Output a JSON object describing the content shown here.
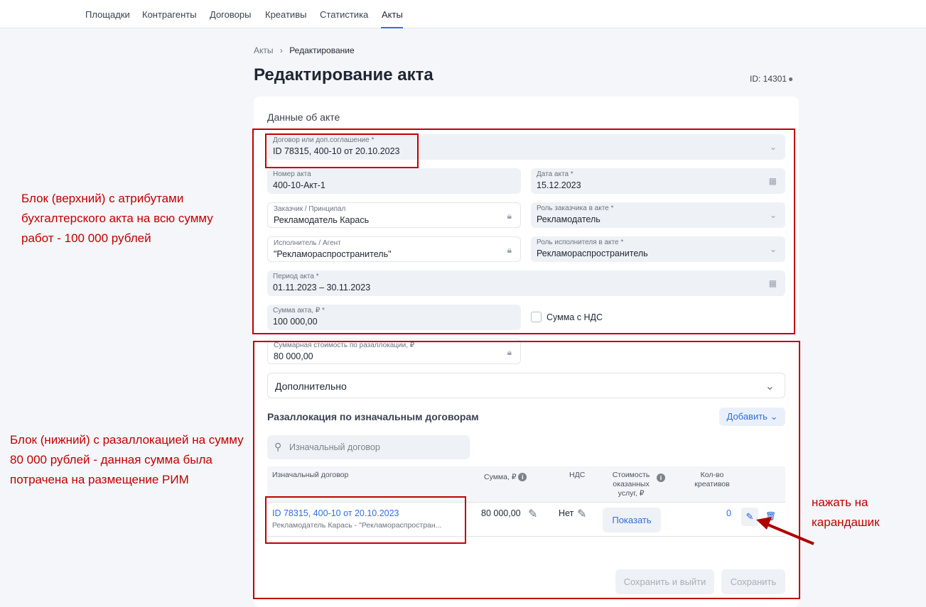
{
  "nav": {
    "items": [
      "Площадки",
      "Контрагенты",
      "Договоры",
      "Креативы",
      "Статистика",
      "Акты"
    ],
    "active": "Акты"
  },
  "breadcrumb": {
    "root": "Акты",
    "current": "Редактирование"
  },
  "page": {
    "title": "Редактирование акта",
    "id": "ID: 14301"
  },
  "form": {
    "section_title": "Данные об акте",
    "contract": {
      "label": "Договор или доп.соглашение *",
      "value": "ID 78315, 400-10 от 20.10.2023"
    },
    "act_number": {
      "label": "Номер акта",
      "value": "400-10-Акт-1"
    },
    "act_date": {
      "label": "Дата акта *",
      "value": "15.12.2023"
    },
    "customer": {
      "label": "Заказчик / Принципал",
      "value": "Рекламодатель Карась"
    },
    "customer_role": {
      "label": "Роль заказчика в акте *",
      "value": "Рекламодатель"
    },
    "executor": {
      "label": "Исполнитель / Агент",
      "value": "\"Рекламораспространитель\""
    },
    "executor_role": {
      "label": "Роль исполнителя в акте *",
      "value": "Рекламораспространитель"
    },
    "period": {
      "label": "Период акта *",
      "value": "01.11.2023 – 30.11.2023"
    },
    "amount": {
      "label": "Сумма акта, ₽ *",
      "value": "100 000,00"
    },
    "vat_checkbox": {
      "label": "Сумма с НДС",
      "checked": false
    },
    "realloc_total": {
      "label": "Суммарная стоимость по разаллокации, ₽",
      "value": "80 000,00"
    },
    "additional": "Дополнительно"
  },
  "realloc": {
    "title": "Разаллокация по изначальным договорам",
    "add_button": "Добавить",
    "search_placeholder": "Изначальный договор",
    "columns": {
      "contract": "Изначальный договор",
      "sum": "Сумма, ₽",
      "vat": "НДС",
      "cost": "Стоимость оказанных услуг, ₽",
      "creatives": "Кол-во креативов"
    },
    "rows": [
      {
        "contract": "ID 78315, 400-10 от 20.10.2023",
        "parties": "Рекламодатель Карась - \"Рекламораспростран...",
        "sum": "80 000,00",
        "vat": "Нет",
        "cost_button": "Показать",
        "creatives": "0"
      }
    ]
  },
  "actions": {
    "save_exit": "Сохранить и выйти",
    "save": "Сохранить"
  },
  "annotations": {
    "top": "Блок (верхний) с атрибутами бухгалтерского акта на всю сумму работ - 100 000 рублей",
    "bottom": "Блок (нижний) с разаллокацией на сумму 80 000 рублей - данная сумма была потрачена на размещение РИМ",
    "hint": "нажать на карандашик",
    "color": "#c00000"
  },
  "colors": {
    "accent": "#2f6fe0",
    "background": "#f5f6f9",
    "field": "#eef1f5"
  }
}
